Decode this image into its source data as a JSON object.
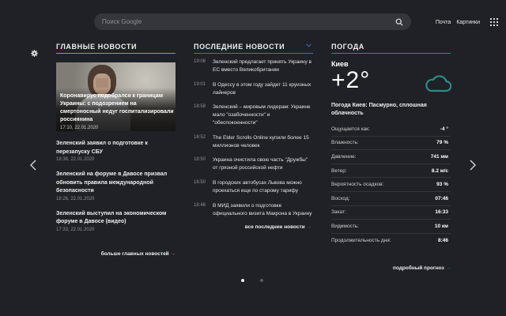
{
  "search": {
    "placeholder": "Поиск Google"
  },
  "top_links": {
    "mail": "Почта",
    "images": "Картинки"
  },
  "main_news": {
    "heading": "ГЛАВНЫЕ НОВОСТИ",
    "hero": {
      "title": "Коронавирус подобрался к границам Украины: с подозрением на смертоносный недуг госпитализировали россиянина",
      "date": "17:10, 22.01.2020"
    },
    "items": [
      {
        "title": "Зеленский заявил о подготовке к перезапуску СБУ",
        "date": "18:38, 22.01.2020"
      },
      {
        "title": "Зеленский на форуме в Давосе призвал обновить правила международной безопасности",
        "date": "18:26, 22.01.2020"
      },
      {
        "title": "Зеленский выступил на экономическом форуме в Давосе (видео)",
        "date": "17:33, 22.01.2020"
      }
    ],
    "more": "больше главных новостей",
    "more_arrow": "→"
  },
  "latest_news": {
    "heading": "ПОСЛЕДНИЕ НОВОСТИ",
    "items": [
      {
        "time": "19:06",
        "title": "Зеленский предлагает принять Украину в ЕС вместо Великобритании"
      },
      {
        "time": "19:01",
        "title": "В Одессу в этом году зайдет 11 круизных лайнеров"
      },
      {
        "time": "18:58",
        "title": "Зеленский – мировым лидерам: Украине мало \"озабоченности\" и \"обеспокоенности\""
      },
      {
        "time": "18:52",
        "title": "The Elder Scrolls Online купили более 15 миллионов человек"
      },
      {
        "time": "18:50",
        "title": "Украина очистила свою часть \"Дружбы\" от грязной российской нефти"
      },
      {
        "time": "18:50",
        "title": "В городских автобусах Львова можно проехаться еще по старому тарифу"
      },
      {
        "time": "18:48",
        "title": "В МИД заявили о подготовке официального визита Макрона в Украину"
      }
    ],
    "more": "все последние новости",
    "more_arrow": "→"
  },
  "weather": {
    "heading": "ПОГОДА",
    "city": "Киев",
    "temperature": "+2°",
    "condition": "Погода Киев: Пасмурно, сплошная облачность",
    "rows": [
      {
        "label": "Ощущается как:",
        "value": "-4 °"
      },
      {
        "label": "Влажность:",
        "value": "79 %"
      },
      {
        "label": "Давление:",
        "value": "741 мм"
      },
      {
        "label": "Ветер:",
        "value": "8.2 м/с"
      },
      {
        "label": "Вероятность осадков:",
        "value": "93 %"
      },
      {
        "label": "Восход:",
        "value": "07:46"
      },
      {
        "label": "Закат:",
        "value": "16:33"
      },
      {
        "label": "Видимость:",
        "value": "10 км"
      },
      {
        "label": "Продолжительность дня:",
        "value": "8:46"
      }
    ],
    "more": "подробный прогноз",
    "more_arrow": "→"
  },
  "icons": {
    "search": "search-icon",
    "apps": "apps-grid-icon",
    "settings": "gear-icon",
    "prev": "chevron-left-icon",
    "next": "chevron-right-icon",
    "weather": "cloud-icon"
  },
  "colors": {
    "background": "#1f2126",
    "main_accent": "#d98a1f",
    "latest_accent": "#4b6fa8",
    "weather_accent": "#2f8a85"
  },
  "carousel": {
    "pages": 2,
    "active": 1
  }
}
